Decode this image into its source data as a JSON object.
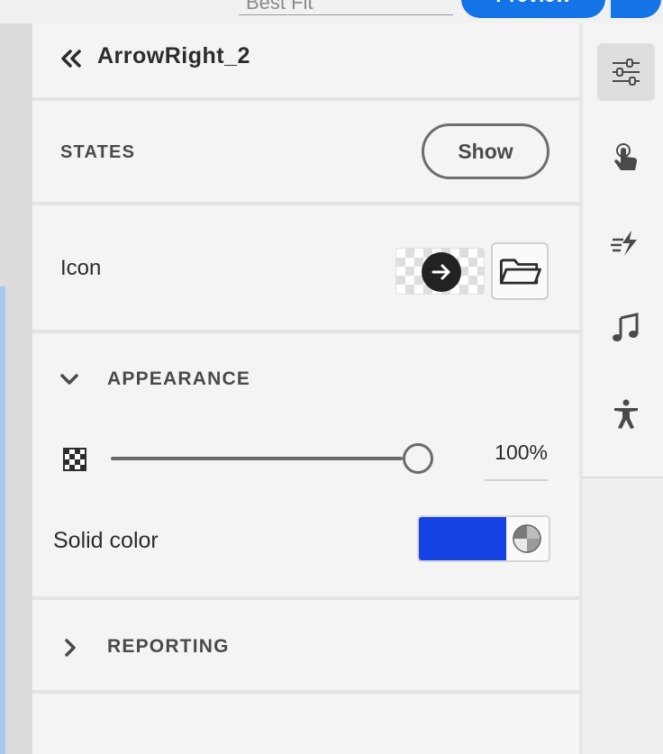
{
  "topbar": {
    "zoom_value": "Best Fit",
    "preview_label": "Preview"
  },
  "panel": {
    "object_name": "ArrowRight_2",
    "states": {
      "label": "STATES",
      "show_label": "Show"
    },
    "icon": {
      "label": "Icon"
    },
    "appearance": {
      "label": "APPEARANCE",
      "opacity_value": "100%",
      "opacity_level": 1.0,
      "solid_color_label": "Solid color",
      "solid_color": "#1542e3"
    },
    "reporting": {
      "label": "REPORTING"
    }
  },
  "rail": {
    "items": [
      "properties-icon",
      "interaction-icon",
      "effects-icon",
      "audio-icon",
      "accessibility-icon"
    ]
  }
}
